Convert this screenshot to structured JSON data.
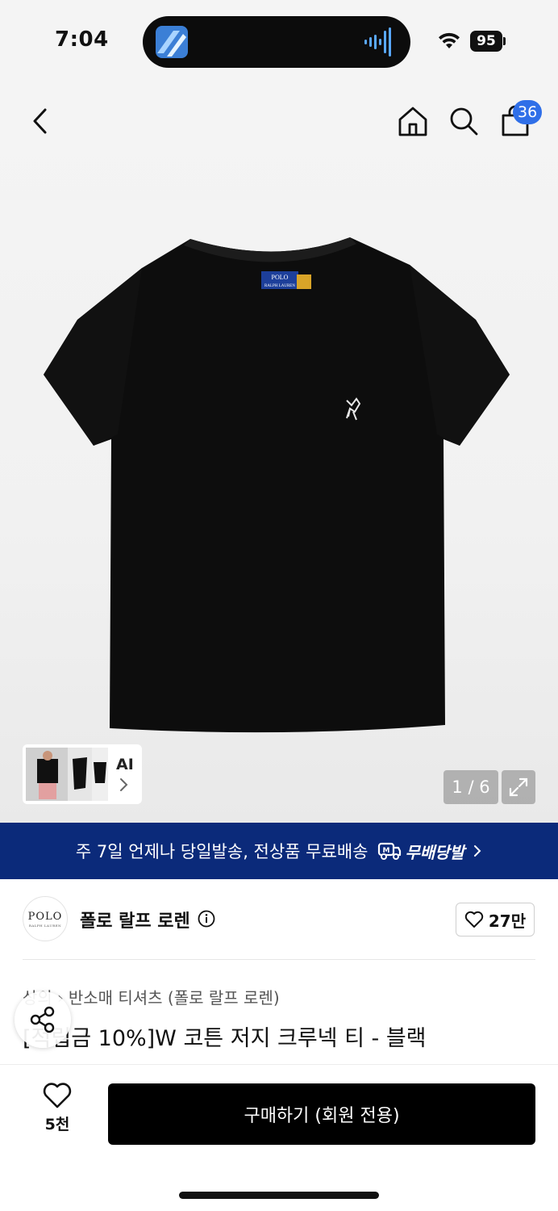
{
  "status_bar": {
    "time": "7:04",
    "battery": "95",
    "icons": [
      "wifi-icon",
      "battery-icon",
      "audio-wave-icon"
    ]
  },
  "header": {
    "icons": [
      "back-icon",
      "home-icon",
      "search-icon",
      "cart-icon"
    ],
    "cart_count": "36"
  },
  "gallery": {
    "tshirt_logo_line1": "POLO",
    "tshirt_logo_line2": "RALPH LAUREN",
    "ai_label": "AI",
    "page_indicator": "1 / 6"
  },
  "banner": {
    "text": "주 7일 언제나 당일발송, 전상품 무료배송",
    "badge": "무배당발",
    "colors": {
      "background": "#0b2a7a",
      "text": "#ffffff"
    }
  },
  "brand": {
    "logo_main": "POLO",
    "logo_sub": "RALPH LAUREN",
    "name": "폴로 랄프 로렌",
    "likes": "27만"
  },
  "breadcrumb": {
    "items": [
      "상의",
      "반소매 티셔츠 (폴로 랄프 로렌)"
    ]
  },
  "product": {
    "title": "[적립금 10%]W 코튼 저지 크루넥 티 - 블랙"
  },
  "bottom_bar": {
    "wish_count": "5천",
    "buy_label": "구매하기 (회원 전용)"
  },
  "colors": {
    "accent_badge": "#2f6fe8",
    "buy_button": "#000000"
  }
}
